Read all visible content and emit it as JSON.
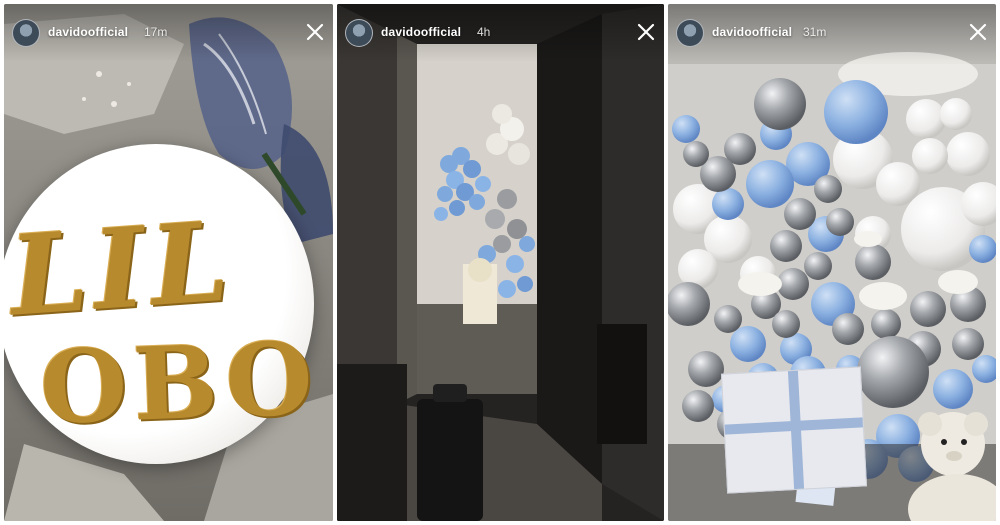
{
  "stories": [
    {
      "username": "davidoofficial",
      "time": "17m",
      "cake_text": [
        "LIL",
        "OBO"
      ]
    },
    {
      "username": "davidoofficial",
      "time": "4h"
    },
    {
      "username": "davidoofficial",
      "time": "31m"
    }
  ],
  "icons": {
    "close": "close-icon",
    "avatar": "avatar"
  },
  "colors": {
    "balloon_blue": "#7fa9dc",
    "balloon_silver": "#9a9ca0",
    "balloon_white": "#f2f2f0",
    "cake_gold": "#b88a2e"
  }
}
